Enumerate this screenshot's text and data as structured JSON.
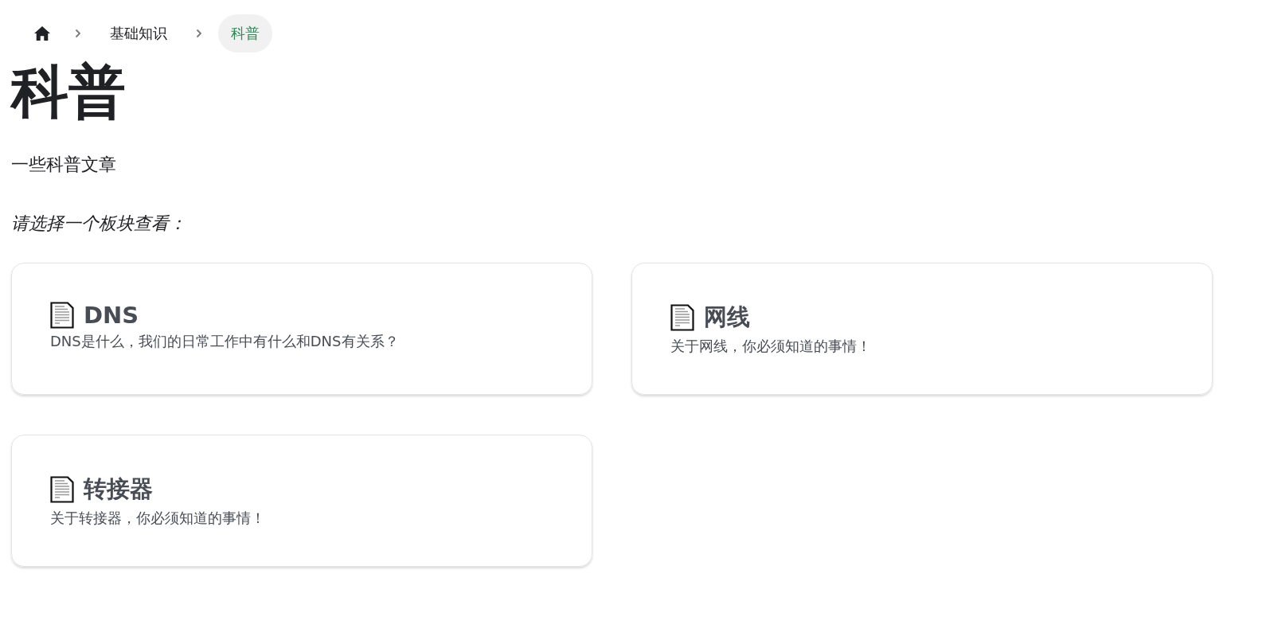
{
  "breadcrumb": [
    {
      "kind": "home",
      "selected": false
    },
    {
      "kind": "link",
      "label": "基础知识",
      "selected": false
    },
    {
      "kind": "link",
      "label": "科普",
      "selected": true
    }
  ],
  "title": "科普",
  "description": "一些科普文章",
  "prompt": "请选择一个板块查看：",
  "cards": [
    {
      "title": "DNS",
      "summary": "DNS是什么，我们的日常工作中有什么和DNS有关系？"
    },
    {
      "title": "网线",
      "summary": "关于网线，你必须知道的事情！"
    },
    {
      "title": "转接器",
      "summary": "关于转接器，你必须知道的事情！"
    }
  ]
}
